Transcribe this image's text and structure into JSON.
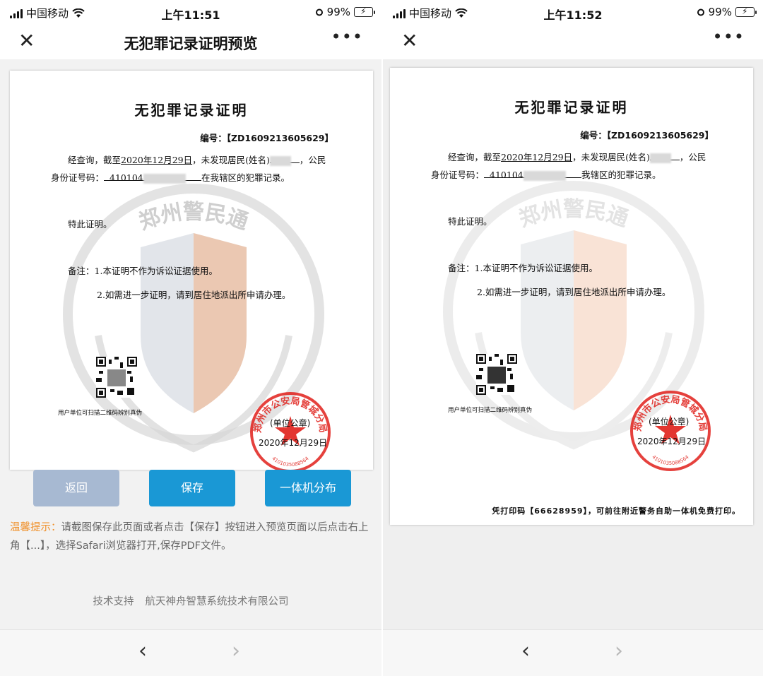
{
  "status_left": {
    "carrier": "中国移动",
    "time": "上午11:51",
    "battery": "99%"
  },
  "status_right": {
    "carrier": "中国移动",
    "time": "上午11:52",
    "battery": "99%"
  },
  "nav_left": {
    "title": "无犯罪记录证明预览",
    "more": "•••"
  },
  "nav_right": {
    "title": "",
    "more": "•••"
  },
  "icons": {
    "close": "close-icon",
    "more": "more-icon",
    "wifi": "wifi-icon",
    "battery": "battery-icon",
    "alarm": "alarm-icon",
    "back": "chevron-left-icon",
    "forward": "chevron-right-icon"
  },
  "certificate": {
    "title": "无犯罪记录证明",
    "number_label": "编号：",
    "number_value": "【ZD1609213605629】",
    "line1_prefix": "经查询，截至",
    "date_filled": "2020年12月29日",
    "line1_mid": "，未发现居民(姓名)",
    "line1_suffix": "，公民",
    "id_label": "身份证号码：",
    "id_partial": "410104",
    "line2_suffix": "在我辖区的犯罪记录。",
    "line2_suffix_right": "我辖区的犯罪记录。",
    "hereby": "特此证明。",
    "remark_label": "备注：",
    "remark1": "1.本证明不作为诉讼证据使用。",
    "remark2": "2.如需进一步证明，请到居住地派出所申请办理。",
    "qr_caption": "用户单位可扫描二维码辨别真伪",
    "seal_unit": "(单位公章)",
    "seal_date": "2020年12月29日",
    "seal_ring_text": "郑州市公安局管城分局",
    "seal_number": "4101035088564",
    "watermark_text": "郑州警民通",
    "print_code_text": "凭打印码【66628959】，可前往附近警务自助一体机免费打印。"
  },
  "buttons": {
    "back": "返回",
    "save": "保存",
    "kiosk": "一体机分布"
  },
  "tip": {
    "label": "温馨提示：",
    "text": "请截图保存此页面或者点击【保存】按钮进入预览页面以后点击右上角【...】，选择Safari浏览器打开,保存PDF文件。"
  },
  "support": {
    "label": "技术支持",
    "company": "航天神舟智慧系统技术有限公司"
  },
  "nav_bottom": {
    "back": "‹",
    "forward": "›"
  },
  "colors": {
    "accent": "#1a98d5",
    "disabled": "#a7b9d2",
    "seal": "#e0201b",
    "tip_label": "#f0912c"
  }
}
